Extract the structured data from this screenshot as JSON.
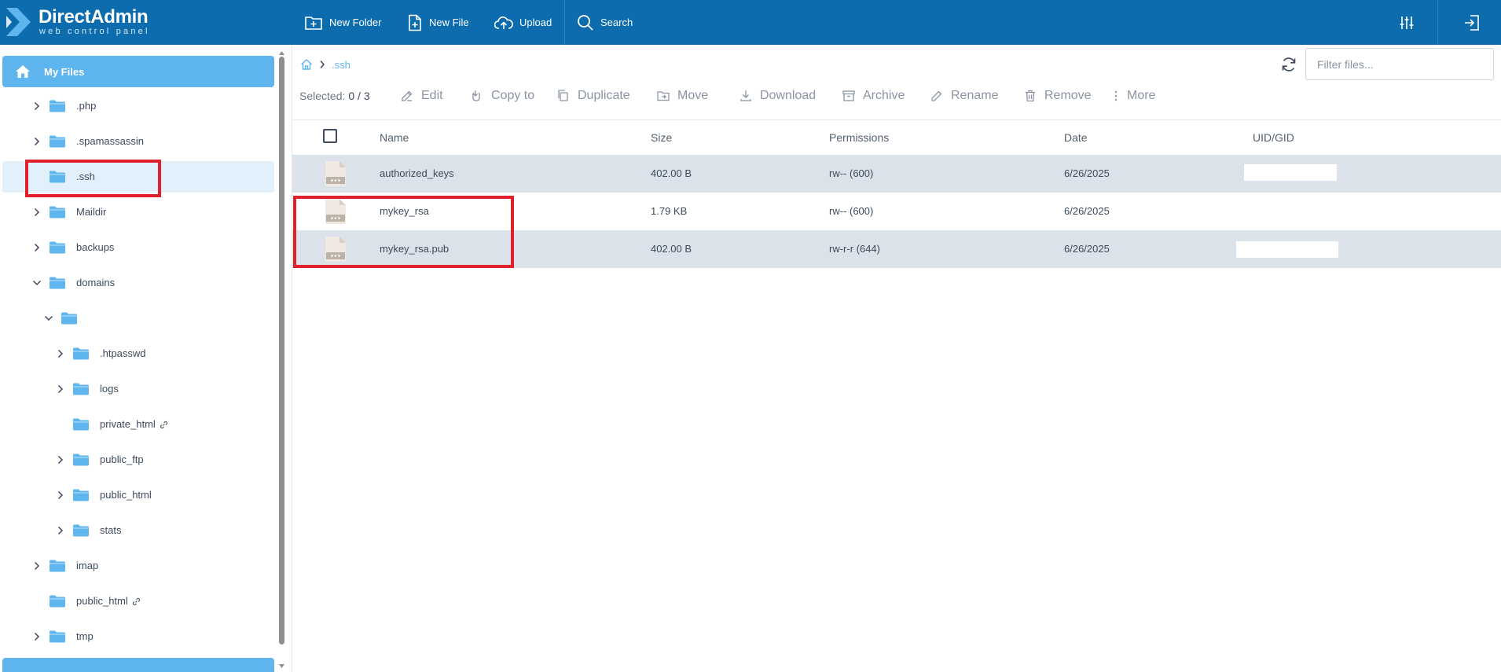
{
  "header": {
    "logo_title": "DirectAdmin",
    "logo_subtitle": "web control panel",
    "buttons": {
      "new_folder": "New Folder",
      "new_file": "New File",
      "upload": "Upload",
      "search": "Search"
    },
    "icons": [
      "settings-sliders-icon",
      "logout-icon"
    ]
  },
  "sidebar": {
    "my_files": "My Files",
    "items": [
      {
        "label": ".php"
      },
      {
        "label": ".spamassassin"
      },
      {
        "label": ".ssh"
      },
      {
        "label": "Maildir"
      },
      {
        "label": "backups"
      },
      {
        "label": "domains"
      },
      {
        "label": ""
      },
      {
        "label": ".htpasswd"
      },
      {
        "label": "logs"
      },
      {
        "label": "private_html"
      },
      {
        "label": "public_ftp"
      },
      {
        "label": "public_html"
      },
      {
        "label": "stats"
      },
      {
        "label": "imap"
      },
      {
        "label": "public_html"
      },
      {
        "label": "tmp"
      }
    ]
  },
  "breadcrumb": {
    "current": ".ssh"
  },
  "filter": {
    "placeholder": "Filter files..."
  },
  "toolbar": {
    "selected_label": "Selected:",
    "selected_count": "0 / 3",
    "actions": {
      "edit": "Edit",
      "copy_to": "Copy to",
      "duplicate": "Duplicate",
      "move": "Move",
      "download": "Download",
      "archive": "Archive",
      "rename": "Rename",
      "remove": "Remove",
      "more": "More"
    }
  },
  "table": {
    "columns": {
      "name": "Name",
      "size": "Size",
      "permissions": "Permissions",
      "date": "Date",
      "uid_gid": "UID/GID"
    },
    "rows": [
      {
        "name": "authorized_keys",
        "size": "402.00 B",
        "permissions": "rw-- (600)",
        "date": "6/26/2025"
      },
      {
        "name": "mykey_rsa",
        "size": "1.79 KB",
        "permissions": "rw-- (600)",
        "date": "6/26/2025"
      },
      {
        "name": "mykey_rsa.pub",
        "size": "402.00 B",
        "permissions": "rw-r-r (644)",
        "date": "6/26/2025"
      }
    ]
  },
  "colors": {
    "header_bg": "#0d6cad",
    "accent": "#5fb6ee",
    "row_shade": "#dbe2ea",
    "highlight": "#e0202a"
  }
}
